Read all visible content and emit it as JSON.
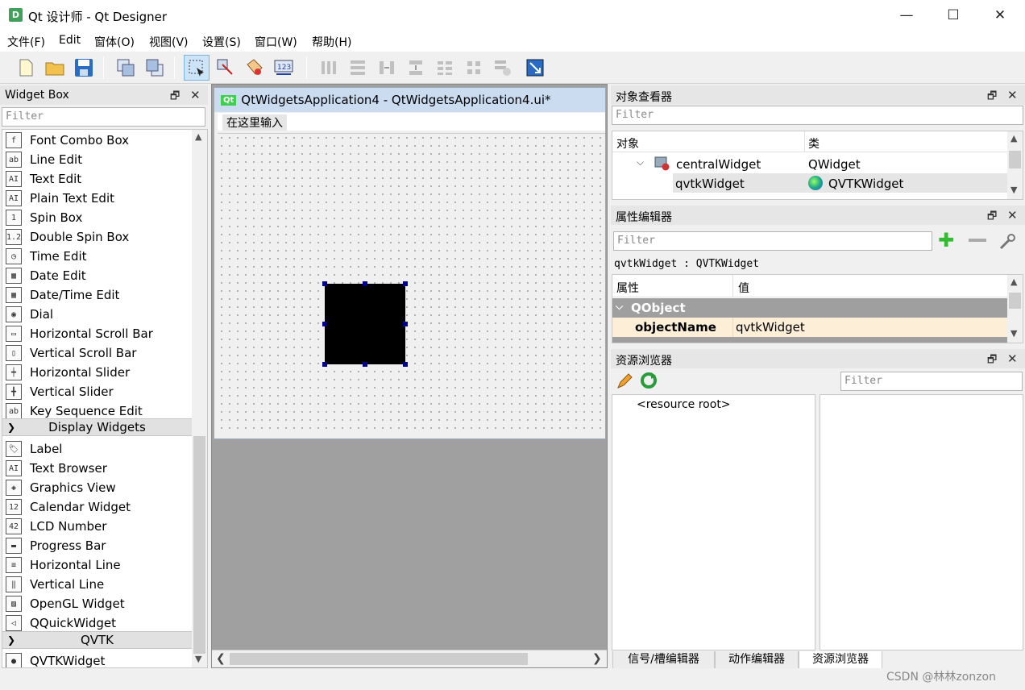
{
  "window": {
    "title": "Qt 设计师 - Qt Designer",
    "app_icon_letter": "D",
    "min": "—",
    "max": "☐",
    "close": "✕"
  },
  "menu": [
    "文件(F)",
    "Edit",
    "窗体(O)",
    "视图(V)",
    "设置(S)",
    "窗口(W)",
    "帮助(H)"
  ],
  "widget_box": {
    "title": "Widget Box",
    "filter_placeholder": "Filter",
    "items": [
      {
        "label": "Font Combo Box",
        "icon": "f"
      },
      {
        "label": "Line Edit",
        "icon": "ab"
      },
      {
        "label": "Text Edit",
        "icon": "AI"
      },
      {
        "label": "Plain Text Edit",
        "icon": "AI"
      },
      {
        "label": "Spin Box",
        "icon": "1"
      },
      {
        "label": "Double Spin Box",
        "icon": "1.2"
      },
      {
        "label": "Time Edit",
        "icon": "◷"
      },
      {
        "label": "Date Edit",
        "icon": "▦"
      },
      {
        "label": "Date/Time Edit",
        "icon": "▦"
      },
      {
        "label": "Dial",
        "icon": "◉"
      },
      {
        "label": "Horizontal Scroll Bar",
        "icon": "▭"
      },
      {
        "label": "Vertical Scroll Bar",
        "icon": "▯"
      },
      {
        "label": "Horizontal Slider",
        "icon": "┿"
      },
      {
        "label": "Vertical Slider",
        "icon": "╋"
      },
      {
        "label": "Key Sequence Edit",
        "icon": "ab"
      }
    ],
    "category_display": "Display Widgets",
    "display_items": [
      {
        "label": "Label",
        "icon": "🏷"
      },
      {
        "label": "Text Browser",
        "icon": "AI"
      },
      {
        "label": "Graphics View",
        "icon": "◈"
      },
      {
        "label": "Calendar Widget",
        "icon": "12"
      },
      {
        "label": "LCD Number",
        "icon": "42"
      },
      {
        "label": "Progress Bar",
        "icon": "▬"
      },
      {
        "label": "Horizontal Line",
        "icon": "≡"
      },
      {
        "label": "Vertical Line",
        "icon": "‖"
      },
      {
        "label": "OpenGL Widget",
        "icon": "▨"
      },
      {
        "label": "QQuickWidget",
        "icon": "◁"
      }
    ],
    "category_qvtk": "QVTK",
    "qvtk_items": [
      {
        "label": "QVTKWidget",
        "icon": "●"
      }
    ]
  },
  "form": {
    "title": "QtWidgetsApplication4 - QtWidgetsApplication4.ui*",
    "badge": "Qt",
    "menu_placeholder": "在这里输入"
  },
  "object_inspector": {
    "title": "对象查看器",
    "filter_placeholder": "Filter",
    "col_object": "对象",
    "col_class": "类",
    "rows": [
      {
        "object": "centralWidget",
        "class": "QWidget"
      },
      {
        "object": "qvtkWidget",
        "class": "QVTKWidget"
      }
    ]
  },
  "property_editor": {
    "title": "属性编辑器",
    "filter_placeholder": "Filter",
    "context": "qvtkWidget : QVTKWidget",
    "col_property": "属性",
    "col_value": "值",
    "group": "QObject",
    "prop_name": "objectName",
    "prop_value": "qvtkWidget"
  },
  "resource_browser": {
    "title": "资源浏览器",
    "filter_placeholder": "Filter",
    "root": "<resource root>"
  },
  "bottom_tabs": [
    "信号/槽编辑器",
    "动作编辑器",
    "资源浏览器"
  ],
  "watermark": "CSDN @林林zonzon"
}
